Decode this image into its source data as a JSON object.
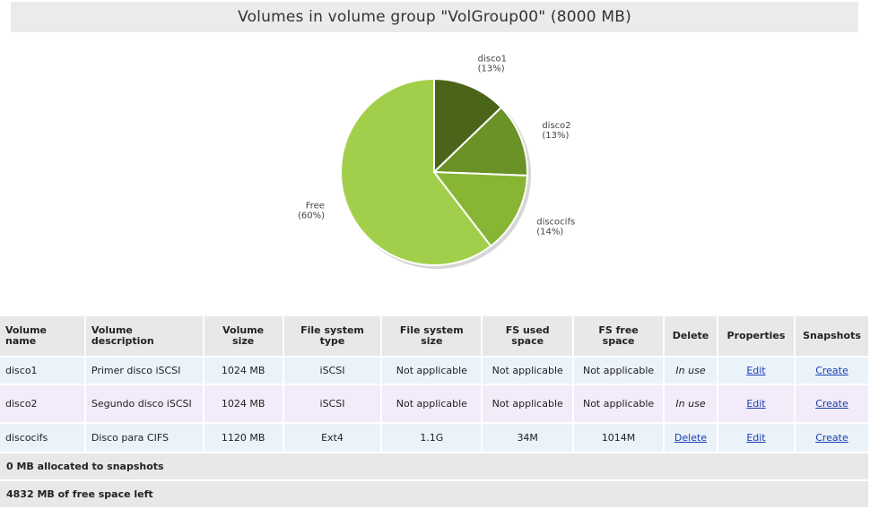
{
  "title": "Volumes in volume group \"VolGroup00\" (8000 MB)",
  "chart_data": {
    "type": "pie",
    "slices": [
      {
        "label": "disco1",
        "pct_label": "(13%)",
        "value": 1024,
        "color": "#4a6519"
      },
      {
        "label": "disco2",
        "pct_label": "(13%)",
        "value": 1024,
        "color": "#6a9227"
      },
      {
        "label": "discocifs",
        "pct_label": "(14%)",
        "value": 1120,
        "color": "#88b534"
      },
      {
        "label": "Free",
        "pct_label": "(60%)",
        "value": 4832,
        "color": "#a2cf4b"
      }
    ]
  },
  "table": {
    "headers": {
      "name_1": "Volume",
      "name_2": "name",
      "desc_1": "Volume",
      "desc_2": "description",
      "size_1": "Volume",
      "size_2": "size",
      "fstype_1": "File system",
      "fstype_2": "type",
      "fssize_1": "File system",
      "fssize_2": "size",
      "used_1": "FS used",
      "used_2": "space",
      "free_1": "FS free",
      "free_2": "space",
      "delete": "Delete",
      "properties": "Properties",
      "snapshots": "Snapshots"
    },
    "rows": [
      {
        "name": "disco1",
        "description": "Primer disco iSCSI",
        "size": "1024 MB",
        "fs_type": "iSCSI",
        "fs_size": "Not applicable",
        "fs_used": "Not applicable",
        "fs_free": "Not applicable",
        "delete": "In use",
        "properties": "Edit",
        "snapshots": "Create"
      },
      {
        "name": "disco2",
        "description": "Segundo disco iSCSI",
        "size": "1024 MB",
        "fs_type": "iSCSI",
        "fs_size": "Not applicable",
        "fs_used": "Not applicable",
        "fs_free": "Not applicable",
        "delete": "In use",
        "properties": "Edit",
        "snapshots": "Create"
      },
      {
        "name": "discocifs",
        "description": "Disco para CIFS",
        "size": "1120 MB",
        "fs_type": "Ext4",
        "fs_size": "1.1G",
        "fs_used": "34M",
        "fs_free": "1014M",
        "delete": "Delete",
        "properties": "Edit",
        "snapshots": "Create"
      }
    ],
    "summary_snapshots": "0 MB allocated to snapshots",
    "summary_free": "4832 MB of free space left"
  }
}
